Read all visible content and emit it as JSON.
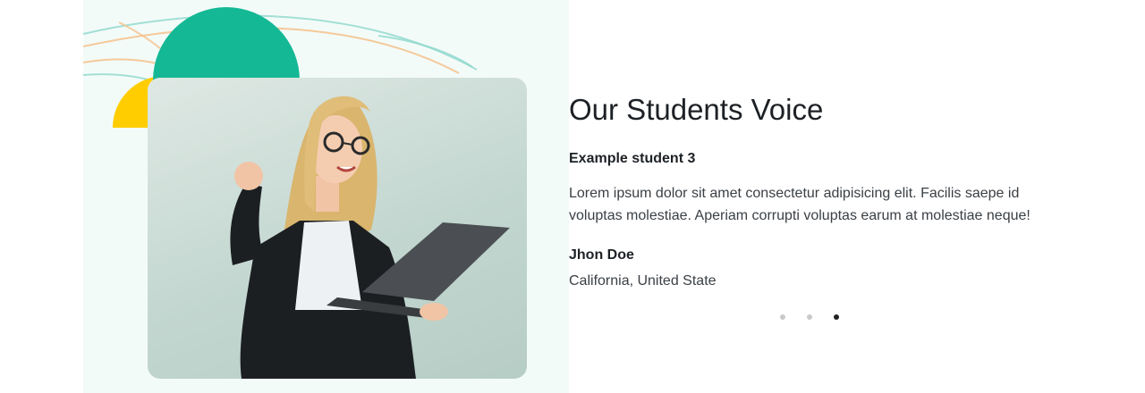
{
  "testimonial": {
    "heading": "Our Students Voice",
    "student_label": "Example student 3",
    "quote": "Lorem ipsum dolor sit amet consectetur adipisicing elit. Facilis saepe id voluptas molestiae. Aperiam corrupti voluptas earum at molestiae neque!",
    "author_name": "Jhon Doe",
    "author_location": "California, United State"
  },
  "carousel": {
    "slide_count": 3,
    "active_index": 3
  },
  "colors": {
    "panel_bg": "#f3fbf9",
    "accent_green": "#14b895",
    "accent_yellow": "#ffcd00",
    "line_orange": "#f5c08a",
    "line_teal": "#8fd8cc",
    "dot_active": "#222222",
    "dot_inactive": "#c9c9c9"
  },
  "image": {
    "subject": "student-with-laptop-photo"
  }
}
